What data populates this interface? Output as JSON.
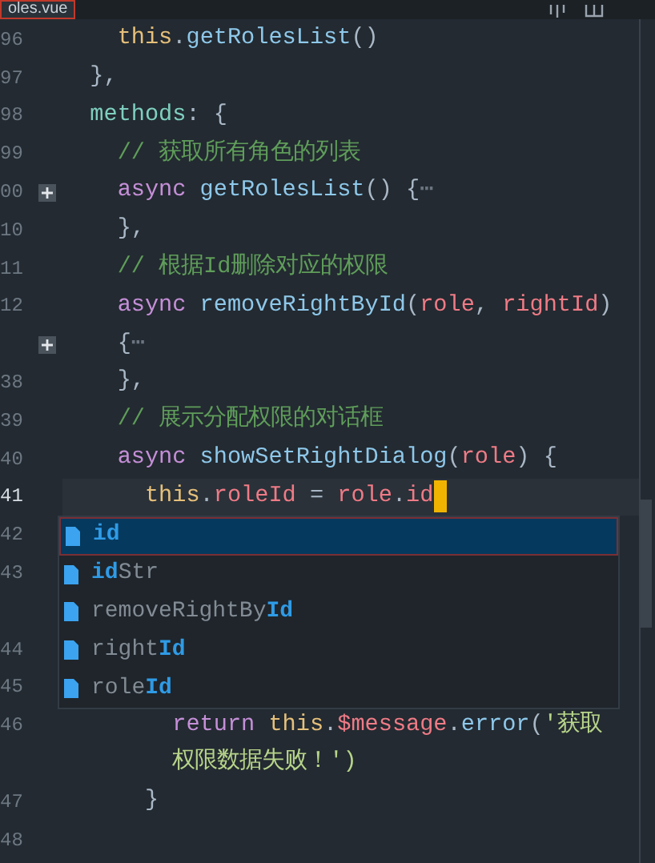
{
  "tab": {
    "title": "oles.vue",
    "selected": true
  },
  "lines": [
    {
      "kind": "line",
      "number": "96",
      "tokens": [
        {
          "kind": "this",
          "text": "    this"
        },
        {
          "kind": "plain",
          "text": "."
        },
        {
          "kind": "func",
          "text": "getRolesList"
        },
        {
          "kind": "plain",
          "text": "()"
        }
      ]
    },
    {
      "kind": "line",
      "number": "97",
      "tokens": [
        {
          "kind": "plain",
          "text": "  },"
        }
      ]
    },
    {
      "kind": "line",
      "number": "98",
      "tokens": [
        {
          "kind": "prop",
          "text": "  methods"
        },
        {
          "kind": "plain",
          "text": ": {"
        }
      ]
    },
    {
      "kind": "line",
      "number": "99",
      "tokens": [
        {
          "kind": "comment",
          "text": "    // 获取所有角色的列表"
        }
      ]
    },
    {
      "kind": "line",
      "number": "00",
      "fold": true,
      "tokens": [
        {
          "kind": "keyword",
          "text": "    async "
        },
        {
          "kind": "func",
          "text": "getRolesList"
        },
        {
          "kind": "plain",
          "text": "() {"
        },
        {
          "kind": "dim",
          "text": "⋯"
        }
      ]
    },
    {
      "kind": "line",
      "number": "10",
      "tokens": [
        {
          "kind": "plain",
          "text": "    },"
        }
      ]
    },
    {
      "kind": "line",
      "number": "11",
      "tokens": [
        {
          "kind": "comment",
          "text": "    // 根据Id删除对应的权限"
        }
      ]
    },
    {
      "kind": "line",
      "number": "12",
      "tokens": [
        {
          "kind": "keyword",
          "text": "    async "
        },
        {
          "kind": "func",
          "text": "removeRightById"
        },
        {
          "kind": "plain",
          "text": "("
        },
        {
          "kind": "param",
          "text": "role"
        },
        {
          "kind": "plain",
          "text": ", "
        },
        {
          "kind": "param",
          "text": "rightId"
        },
        {
          "kind": "plain",
          "text": ")"
        }
      ]
    },
    {
      "kind": "wrap",
      "fold": true,
      "tokens": [
        {
          "kind": "plain",
          "text": "    {"
        },
        {
          "kind": "dim",
          "text": "⋯"
        }
      ]
    },
    {
      "kind": "line",
      "number": "38",
      "tokens": [
        {
          "kind": "plain",
          "text": "    },"
        }
      ]
    },
    {
      "kind": "line",
      "number": "39",
      "tokens": [
        {
          "kind": "comment",
          "text": "    // 展示分配权限的对话框"
        }
      ]
    },
    {
      "kind": "line",
      "number": "40",
      "tokens": [
        {
          "kind": "keyword",
          "text": "    async "
        },
        {
          "kind": "func",
          "text": "showSetRightDialog"
        },
        {
          "kind": "plain",
          "text": "("
        },
        {
          "kind": "param",
          "text": "role"
        },
        {
          "kind": "plain",
          "text": ") {"
        }
      ]
    },
    {
      "kind": "line",
      "number": "41",
      "current": true,
      "tokens": [
        {
          "kind": "this",
          "text": "      this"
        },
        {
          "kind": "plain",
          "text": "."
        },
        {
          "kind": "param",
          "text": "roleId"
        },
        {
          "kind": "plain",
          "text": " = "
        },
        {
          "kind": "param",
          "text": "role"
        },
        {
          "kind": "plain",
          "text": "."
        },
        {
          "kind": "param",
          "text": "id"
        }
      ]
    },
    {
      "kind": "line",
      "number": "42"
    },
    {
      "kind": "line",
      "number": "43"
    },
    {
      "kind": "wrap"
    },
    {
      "kind": "line",
      "number": "44"
    },
    {
      "kind": "line",
      "number": "45"
    },
    {
      "kind": "line",
      "number": "46",
      "tokens": [
        {
          "kind": "keyword",
          "text": "        return "
        },
        {
          "kind": "this",
          "text": "this"
        },
        {
          "kind": "plain",
          "text": "."
        },
        {
          "kind": "param",
          "text": "$message"
        },
        {
          "kind": "plain",
          "text": "."
        },
        {
          "kind": "func",
          "text": "error"
        },
        {
          "kind": "plain",
          "text": "("
        },
        {
          "kind": "string",
          "text": "'获取"
        }
      ]
    },
    {
      "kind": "wrap",
      "tokens": [
        {
          "kind": "string",
          "text": "        权限数据失败！')"
        }
      ]
    },
    {
      "kind": "line",
      "number": "47",
      "tokens": [
        {
          "kind": "plain",
          "text": "      }"
        }
      ]
    },
    {
      "kind": "line",
      "number": "48"
    }
  ],
  "suggestions": [
    {
      "selected": true,
      "parts": [
        {
          "text": "id",
          "match": true
        }
      ]
    },
    {
      "selected": false,
      "parts": [
        {
          "text": "id",
          "match": true
        },
        {
          "text": "Str",
          "match": false
        }
      ]
    },
    {
      "selected": false,
      "parts": [
        {
          "text": "removeRightBy",
          "match": false
        },
        {
          "text": "Id",
          "match": true
        }
      ]
    },
    {
      "selected": false,
      "parts": [
        {
          "text": "right",
          "match": false
        },
        {
          "text": "Id",
          "match": true
        }
      ]
    },
    {
      "selected": false,
      "parts": [
        {
          "text": "role",
          "match": false
        },
        {
          "text": "Id",
          "match": true
        }
      ]
    }
  ]
}
